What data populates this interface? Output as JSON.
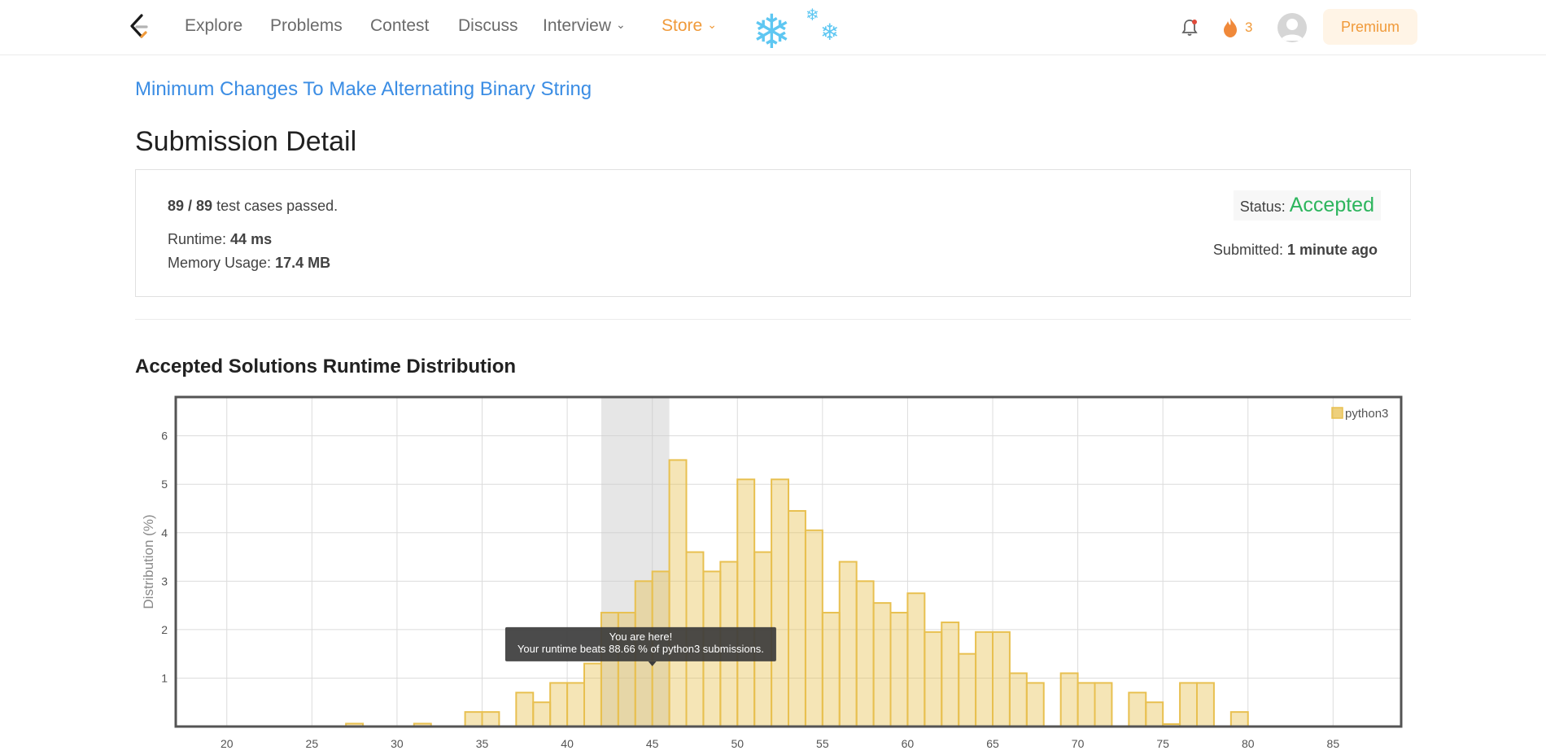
{
  "nav": {
    "items": [
      {
        "key": "explore",
        "label": "Explore"
      },
      {
        "key": "problems",
        "label": "Problems"
      },
      {
        "key": "contest",
        "label": "Contest"
      },
      {
        "key": "discuss",
        "label": "Discuss"
      },
      {
        "key": "interview",
        "label": "Interview"
      },
      {
        "key": "store",
        "label": "Store"
      }
    ],
    "streak_count": "3",
    "premium_label": "Premium",
    "accent_color": "#f09a3a"
  },
  "problem": {
    "title": "Minimum Changes To Make Alternating Binary String"
  },
  "page_title": "Submission Detail",
  "submission": {
    "passed": "89 / 89",
    "passed_suffix": "test cases passed.",
    "runtime_label": "Runtime:",
    "runtime_value": "44 ms",
    "memory_label": "Memory Usage:",
    "memory_value": "17.4 MB",
    "status_label": "Status:",
    "status_value": "Accepted",
    "status_color": "#2db55d",
    "submitted_label": "Submitted:",
    "submitted_value": "1 minute ago"
  },
  "section_title": "Accepted Solutions Runtime Distribution",
  "chart_data": {
    "type": "bar",
    "ylabel": "Distribution (%)",
    "xlabel": "",
    "xlim": [
      17,
      89
    ],
    "ylim": [
      0,
      6.8
    ],
    "xticks": [
      20,
      25,
      30,
      35,
      40,
      45,
      50,
      55,
      60,
      65,
      70,
      75,
      80,
      85
    ],
    "yticks": [
      1,
      2,
      3,
      4,
      5,
      6
    ],
    "legend": "top-right",
    "grid": true,
    "series": [
      {
        "name": "python3",
        "color": "#e8c050",
        "points": [
          [
            27.5,
            0.06
          ],
          [
            31.5,
            0.06
          ],
          [
            34.5,
            0.3
          ],
          [
            35.5,
            0.3
          ],
          [
            37.5,
            0.7
          ],
          [
            38.5,
            0.5
          ],
          [
            39.5,
            0.9
          ],
          [
            40.5,
            0.9
          ],
          [
            41.5,
            1.3
          ],
          [
            42.5,
            2.35
          ],
          [
            43.5,
            2.35
          ],
          [
            44.5,
            3.0
          ],
          [
            45.5,
            3.2
          ],
          [
            46.5,
            5.5
          ],
          [
            47.5,
            3.6
          ],
          [
            48.5,
            3.2
          ],
          [
            49.5,
            3.4
          ],
          [
            50.5,
            5.1
          ],
          [
            51.5,
            3.6
          ],
          [
            52.5,
            5.1
          ],
          [
            53.5,
            4.45
          ],
          [
            54.5,
            4.05
          ],
          [
            55.5,
            2.35
          ],
          [
            56.5,
            3.4
          ],
          [
            57.5,
            3.0
          ],
          [
            58.5,
            2.55
          ],
          [
            59.5,
            2.35
          ],
          [
            60.5,
            2.75
          ],
          [
            61.5,
            1.95
          ],
          [
            62.5,
            2.15
          ],
          [
            63.5,
            1.5
          ],
          [
            64.5,
            1.95
          ],
          [
            65.5,
            1.95
          ],
          [
            66.5,
            1.1
          ],
          [
            67.5,
            0.9
          ],
          [
            69.5,
            1.1
          ],
          [
            70.5,
            0.9
          ],
          [
            71.5,
            0.9
          ],
          [
            73.5,
            0.7
          ],
          [
            74.5,
            0.5
          ],
          [
            75.5,
            0.05
          ],
          [
            76.5,
            0.9
          ],
          [
            77.5,
            0.9
          ],
          [
            79.5,
            0.3
          ]
        ]
      }
    ],
    "highlight_range": [
      42,
      46
    ],
    "tooltip": {
      "line1": "You are here!",
      "line2": "Your runtime beats 88.66 % of python3 submissions."
    }
  }
}
